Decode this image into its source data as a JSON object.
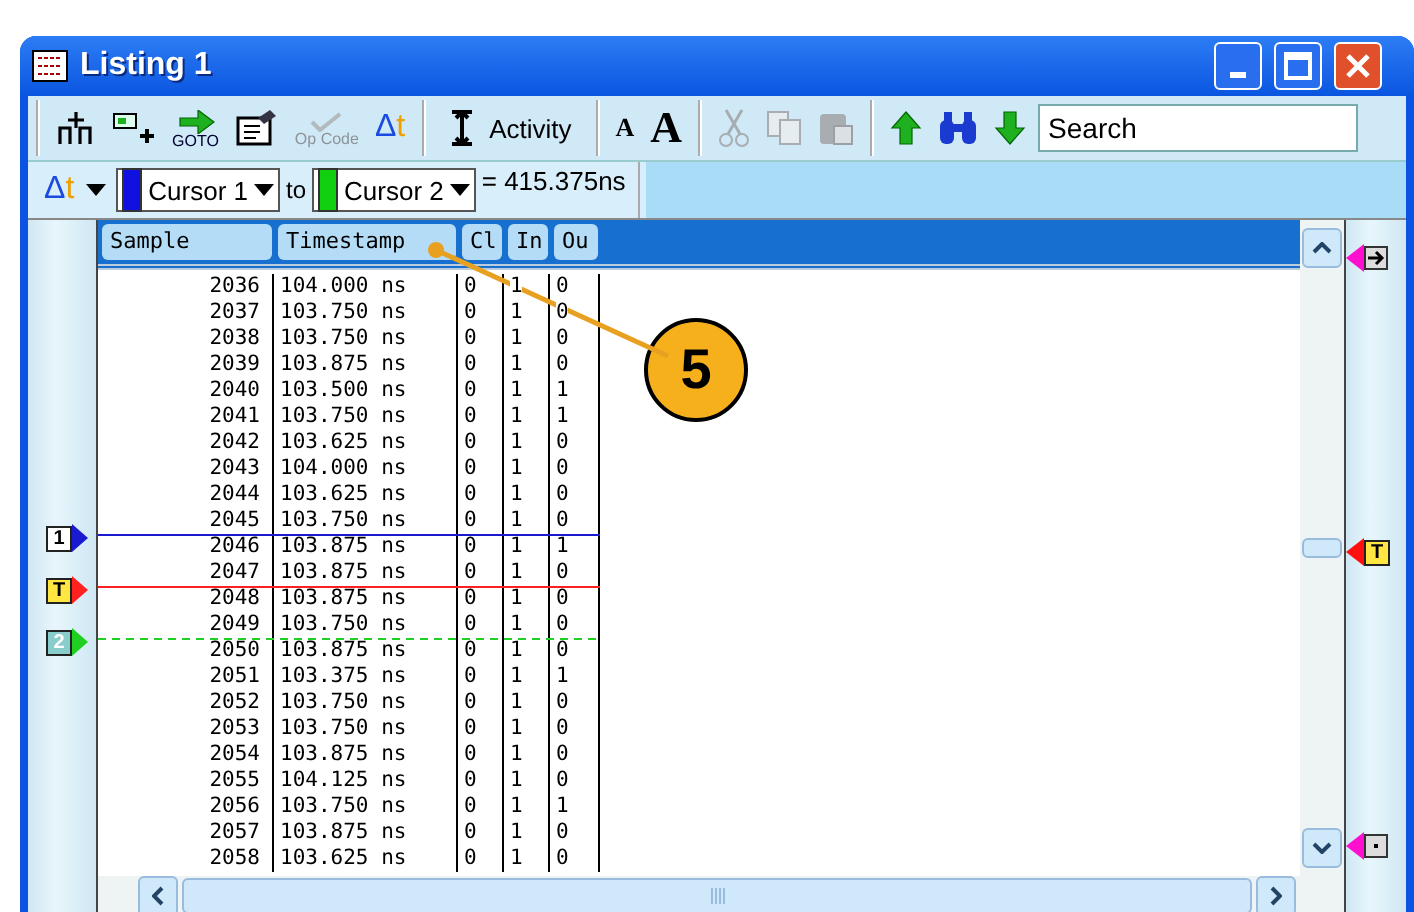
{
  "window": {
    "title": "Listing 1"
  },
  "toolbar": {
    "groups": [
      {
        "items": [
          {
            "kind": "add-column",
            "disabled": false
          },
          {
            "kind": "add-marker",
            "disabled": false
          },
          {
            "kind": "goto",
            "label": "GOTO",
            "disabled": false
          },
          {
            "kind": "properties",
            "disabled": false
          },
          {
            "kind": "opcode",
            "label": "Op Code",
            "disabled": true
          },
          {
            "kind": "delta",
            "label": "Δt",
            "disabled": false
          }
        ]
      },
      {
        "items": [
          {
            "kind": "activity",
            "label": "Activity",
            "disabled": false
          }
        ]
      },
      {
        "items": [
          {
            "kind": "font-small",
            "label": "A",
            "disabled": false
          },
          {
            "kind": "font-large",
            "label": "A",
            "disabled": false
          }
        ]
      },
      {
        "items": [
          {
            "kind": "cut",
            "disabled": true
          },
          {
            "kind": "copy",
            "disabled": true
          },
          {
            "kind": "paste",
            "disabled": true
          }
        ]
      },
      {
        "items": [
          {
            "kind": "up",
            "disabled": false
          },
          {
            "kind": "find",
            "disabled": false
          },
          {
            "kind": "down",
            "disabled": false
          },
          {
            "kind": "search",
            "placeholder": "Search",
            "disabled": false
          }
        ]
      }
    ]
  },
  "cursor_bar": {
    "delta": "Δt",
    "from": {
      "label": "Cursor 1",
      "color": "#1010e0"
    },
    "to_label": "to",
    "to": {
      "label": "Cursor 2",
      "color": "#10d010"
    },
    "result": "= 415.375ns"
  },
  "table": {
    "columns": [
      "Sample",
      "Timestamp",
      "Cl",
      "In",
      "Ou"
    ],
    "rows": [
      {
        "cells": [
          "2036",
          "104.000 ns",
          "0",
          "1",
          "0"
        ]
      },
      {
        "cells": [
          "2037",
          "103.750 ns",
          "0",
          "1",
          "0"
        ]
      },
      {
        "cells": [
          "2038",
          "103.750 ns",
          "0",
          "1",
          "0"
        ]
      },
      {
        "cells": [
          "2039",
          "103.875 ns",
          "0",
          "1",
          "0"
        ]
      },
      {
        "cells": [
          "2040",
          "103.500 ns",
          "0",
          "1",
          "1"
        ]
      },
      {
        "cells": [
          "2041",
          "103.750 ns",
          "0",
          "1",
          "1"
        ]
      },
      {
        "cells": [
          "2042",
          "103.625 ns",
          "0",
          "1",
          "0"
        ]
      },
      {
        "cells": [
          "2043",
          "104.000 ns",
          "0",
          "1",
          "0"
        ]
      },
      {
        "cells": [
          "2044",
          "103.625 ns",
          "0",
          "1",
          "0"
        ]
      },
      {
        "cells": [
          "2045",
          "103.750 ns",
          "0",
          "1",
          "0"
        ],
        "line_below": {
          "marker": "1",
          "kind": "solid",
          "color": "#1a1ad0"
        }
      },
      {
        "cells": [
          "2046",
          "103.875 ns",
          "0",
          "1",
          "1"
        ]
      },
      {
        "cells": [
          "2047",
          "103.875 ns",
          "0",
          "1",
          "0"
        ],
        "line_below": {
          "marker": "T",
          "kind": "solid",
          "color": "#ff2020"
        }
      },
      {
        "cells": [
          "2048",
          "103.875 ns",
          "0",
          "1",
          "0"
        ]
      },
      {
        "cells": [
          "2049",
          "103.750 ns",
          "0",
          "1",
          "0"
        ],
        "line_below": {
          "marker": "2",
          "kind": "dashed",
          "color": "#20d020"
        }
      },
      {
        "cells": [
          "2050",
          "103.875 ns",
          "0",
          "1",
          "0"
        ]
      },
      {
        "cells": [
          "2051",
          "103.375 ns",
          "0",
          "1",
          "1"
        ]
      },
      {
        "cells": [
          "2052",
          "103.750 ns",
          "0",
          "1",
          "0"
        ]
      },
      {
        "cells": [
          "2053",
          "103.750 ns",
          "0",
          "1",
          "0"
        ]
      },
      {
        "cells": [
          "2054",
          "103.875 ns",
          "0",
          "1",
          "0"
        ]
      },
      {
        "cells": [
          "2055",
          "104.125 ns",
          "0",
          "1",
          "0"
        ]
      },
      {
        "cells": [
          "2056",
          "103.750 ns",
          "0",
          "1",
          "1"
        ]
      },
      {
        "cells": [
          "2057",
          "103.875 ns",
          "0",
          "1",
          "0"
        ]
      },
      {
        "cells": [
          "2058",
          "103.625 ns",
          "0",
          "1",
          "0"
        ]
      }
    ]
  },
  "right_markers": [
    {
      "kind": "start",
      "color": "#ff10d0"
    },
    {
      "kind": "trigger",
      "label": "T",
      "color": "#ff1010"
    },
    {
      "kind": "end",
      "color": "#ff10d0"
    }
  ],
  "callout": {
    "label": "5"
  }
}
